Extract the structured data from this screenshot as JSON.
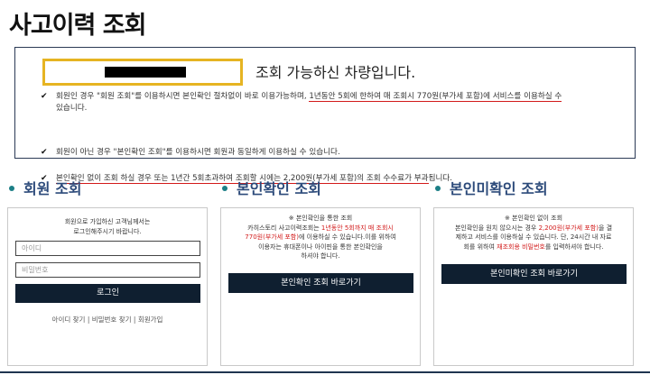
{
  "page": {
    "title": "사고이력 조회"
  },
  "notice": {
    "heading": "조회 가능하신 차량입니다.",
    "item1_pre": "회원인 경우 \"회원 조회\"를 이용하시면 본인확인 절차없이 바로 이용가능하며, ",
    "item1_hl": "1년동안 5회에 한하여 매 조회시 770원(부가세 포함)에 서비스를 이용하실 수",
    "item1_post": "있습니다.",
    "item2": "회원이 아닌 경우 \"본인확인 조회\"를 이용하시면 회원과 동일하게 이용하실 수 있습니다.",
    "item3_hl": "본인확인 없이 조회 하실 경우 또는 1년간 5회초과하여 조회할 시에는 2,200원(부가세 포함)의 조회 수수료가 부과",
    "item3_post": "됩니다."
  },
  "member": {
    "title": "회원 조회",
    "desc_line1": "회원으로 가입하신 고객님께서는",
    "desc_line2": "로그인해주시기 바랍니다.",
    "id_placeholder": "아이디",
    "pw_placeholder": "비밀번호",
    "login_label": "로그인",
    "link_find_id": "아이디 찾기",
    "link_find_pw": "비밀번호 찾기",
    "link_signup": "회원가입",
    "sep": " | "
  },
  "verify": {
    "title": "본인확인 조회",
    "desc_line1": "※ 본인확인을 통한 조회",
    "desc_line2_pre": "카히스토리 사고이력조회는 ",
    "desc_line2_red": "1년동안 5회까지 매 조회시",
    "desc_line3_red": "770원(부가세 포함)",
    "desc_line3_post": "에 이용하실 수 있습니다.이를 위하여",
    "desc_line4": "이용자는 휴대폰이나 아이핀을 통한 본인확인을",
    "desc_line5": "하셔야 합니다.",
    "button_label": "본인확인 조회 바로가기"
  },
  "unverified": {
    "title": "본인미확인 조회",
    "desc_line1": "※ 본인확인 없이 조회",
    "desc_line2_pre": "본인확인을 원치 않으시는 경우 ",
    "desc_line2_red": "2,200원(부가세 포함)",
    "desc_line2_post": "을 결",
    "desc_line3": "제하고 서비스를 이용하실 수 있습니다. 단, 24시간 내 자료",
    "desc_line4_pre": "회를 위하여 ",
    "desc_line4_red": "재조회용 비밀번호",
    "desc_line4_post": "를 입력하셔야 합니다.",
    "button_label": "본인미확인 조회 바로가기"
  }
}
